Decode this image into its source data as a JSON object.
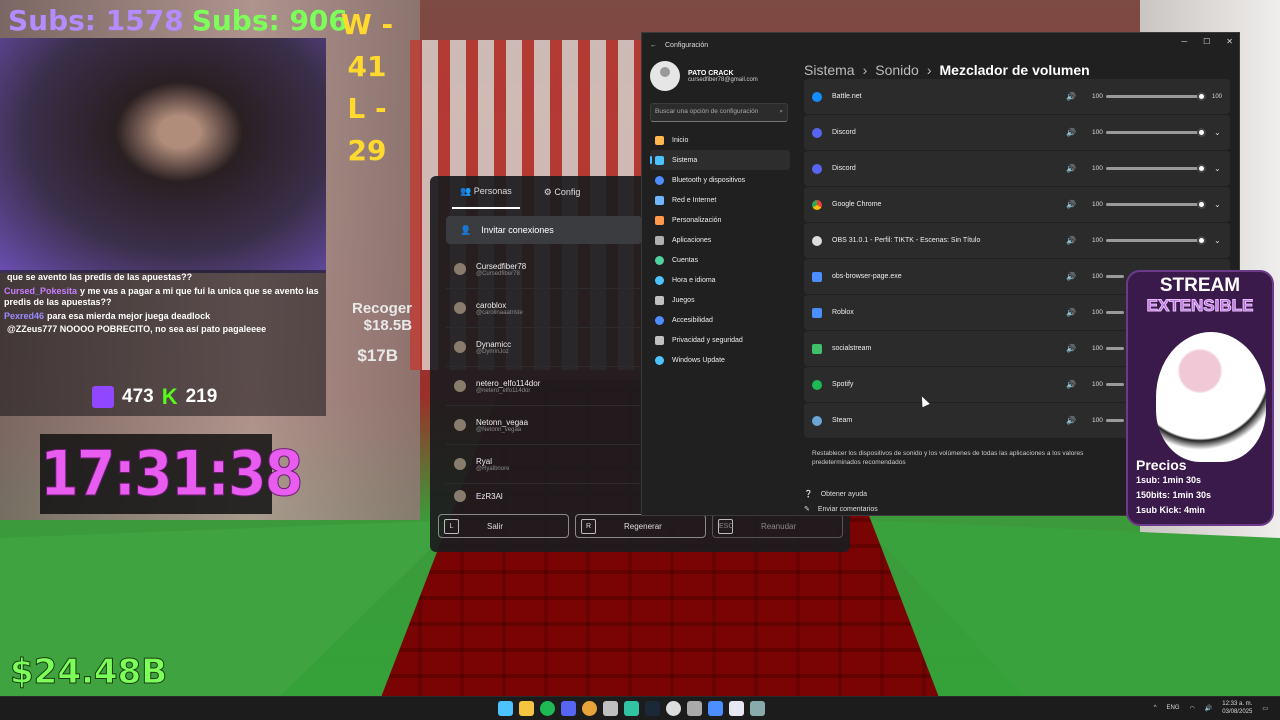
{
  "stream_overlay": {
    "subs1": "Subs: 1578",
    "subs2": "Subs: 906",
    "wins": "W - 41",
    "losses": "L - 29",
    "twitch_viewers": "473",
    "kick_viewers": "219",
    "clock": "17:31:38",
    "money": "$24.48B",
    "recoger_label": "Recoger",
    "recoger_value": "$18.5B",
    "recoger_value2": "$17B"
  },
  "chat": [
    {
      "user": "",
      "text": "que se avento las predis de las apuestas??",
      "color": "#ffffff"
    },
    {
      "user": "Cursed_Pokesita",
      "text": "y me vas a pagar a mi que fui la unica que se avento las predis de las apuestas??",
      "color": "#c77dff"
    },
    {
      "user": "Pexred46",
      "text": "para esa mierda mejor juega deadlock",
      "color": "#9b8cff"
    },
    {
      "user": "",
      "text": "@ZZeus777 NOOOO POBRECITO, no sea así pato pagaleeee",
      "color": "#ffffff"
    }
  ],
  "roblox_menu": {
    "tabs": [
      "Personas",
      "Config"
    ],
    "invite_label": "Invitar conexiones",
    "friends": [
      {
        "name": "Cursedfiber78",
        "handle": "@Cursedfiber78"
      },
      {
        "name": "caroblox",
        "handle": "@carolinaaatriste"
      },
      {
        "name": "Dynamicc",
        "handle": "@DymInJoz"
      },
      {
        "name": "netero_elfo114dor",
        "handle": "@netero_elfo114dor"
      },
      {
        "name": "Netonn_vegaa",
        "handle": "@Netonn_vegaa"
      },
      {
        "name": "Ryal",
        "handle": "@Ryalbnore"
      },
      {
        "name": "EzR3Al",
        "handle": ""
      }
    ],
    "buttons": [
      {
        "key": "L",
        "label": "Salir"
      },
      {
        "key": "R",
        "label": "Regenerar"
      },
      {
        "key": "ESC",
        "label": "Reanudar"
      }
    ]
  },
  "settings": {
    "window_title": "Configuración",
    "profile_name": "PATO CRACK",
    "profile_email": "cursedfiber78@gmail.com",
    "search_placeholder": "Buscar una opción de configuración",
    "nav": [
      {
        "label": "Inicio",
        "color": "#ffb84d"
      },
      {
        "label": "Sistema",
        "color": "#4cc2ff",
        "active": true
      },
      {
        "label": "Bluetooth y dispositivos",
        "color": "#4c8dff"
      },
      {
        "label": "Red e Internet",
        "color": "#6fb6ff"
      },
      {
        "label": "Personalización",
        "color": "#ff9a4d"
      },
      {
        "label": "Aplicaciones",
        "color": "#b0b0b0"
      },
      {
        "label": "Cuentas",
        "color": "#4fd1a0"
      },
      {
        "label": "Hora e idioma",
        "color": "#4cc2ff"
      },
      {
        "label": "Juegos",
        "color": "#c0c0c0"
      },
      {
        "label": "Accesibilidad",
        "color": "#4c8dff"
      },
      {
        "label": "Privacidad y seguridad",
        "color": "#c0c0c0"
      },
      {
        "label": "Windows Update",
        "color": "#4cc2ff"
      }
    ],
    "breadcrumb": [
      "Sistema",
      "Sonido",
      "Mezclador de volumen"
    ],
    "apps": [
      {
        "name": "Battle.net",
        "volume": "100",
        "color": "#148eff",
        "tooltip": "100"
      },
      {
        "name": "Discord",
        "volume": "100",
        "color": "#5865f2"
      },
      {
        "name": "Discord",
        "volume": "100",
        "color": "#5865f2"
      },
      {
        "name": "Google Chrome",
        "volume": "100",
        "color": "#e8a33c"
      },
      {
        "name": "OBS 31.0.1 - Perfil: TIKTK - Escenas: Sin Título",
        "volume": "100",
        "color": "#dddddd"
      },
      {
        "name": "obs-browser-page.exe",
        "volume": "100",
        "color": "#4c8dff"
      },
      {
        "name": "Roblox",
        "volume": "100",
        "color": "#4c8dff"
      },
      {
        "name": "socialstream",
        "volume": "100",
        "color": "#3fbf6a"
      },
      {
        "name": "Spotify",
        "volume": "100",
        "color": "#1db954"
      },
      {
        "name": "Steam",
        "volume": "100",
        "color": "#6aa7d6"
      }
    ],
    "reset_text": "Restablecer los dispositivos de sonido y los volúmenes de todas las aplicaciones a los valores predeterminados recomendados",
    "help": [
      "Obtener ayuda",
      "Enviar comentarios"
    ]
  },
  "stream_panel": {
    "title": "STREAM",
    "subtitle": "EXTENSIBLE",
    "prices_header": "Precios",
    "prices": [
      "1sub: 1min 30s",
      "150bits: 1min 30s",
      "1sub Kick: 4min"
    ]
  },
  "taskbar": {
    "lang": "ENG",
    "time": "12:33 a. m.",
    "date": "03/08/2025"
  }
}
